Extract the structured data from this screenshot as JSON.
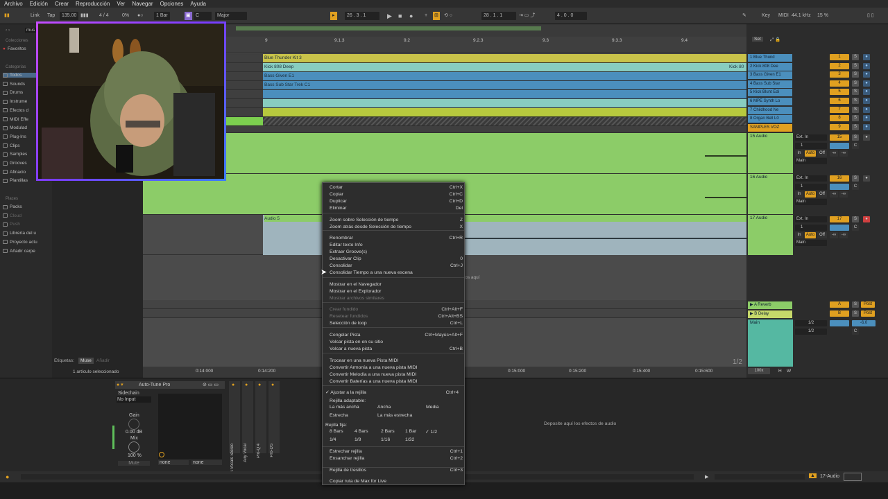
{
  "menubar": [
    "Archivo",
    "Edición",
    "Crear",
    "Reproducción",
    "Ver",
    "Navegar",
    "Opciones",
    "Ayuda"
  ],
  "transport": {
    "link": "Link",
    "tap": "Tap",
    "tempo": "135.00",
    "sig": "4 / 4",
    "pct": "0%",
    "quant": "1 Bar",
    "key": "C",
    "scale": "Major",
    "pos": "26 . 3 . 1",
    "loop_start": "28 . 1 . 1",
    "loop_len": "4 . 0 . 0",
    "key_label": "Key",
    "midi": "MIDI",
    "sample_rate": "44.1 kHz",
    "cpu": "15 %"
  },
  "browser": {
    "search": "mus",
    "section_colecciones": "Colecciones",
    "favoritos": "Favoritos",
    "section_categorias": "Categorías",
    "categorias": [
      "Todos",
      "Sounds",
      "Drums",
      "Instrume",
      "Efectos d",
      "MIDI Effe",
      "Modulad",
      "Plug-Ins",
      "Clips",
      "Samples",
      "Grooves",
      "Afinacio",
      "Plantillas"
    ],
    "section_lugares": "Places",
    "lugares": [
      "Packs",
      "Cloud",
      "Push",
      "Librería del u",
      "Proyecto actu",
      "Añadir carpe"
    ],
    "tags_label": "Etiquetas:",
    "tag1": "Muse",
    "tag2": "Añadir",
    "selected": "1 artículo seleccionado"
  },
  "ruler": {
    "marks": [
      "9",
      "9.1.3",
      "9.2",
      "9.2.3",
      "9.3",
      "9.3.3",
      "9.4"
    ],
    "set": "Set"
  },
  "clips": {
    "c1": "Blue Thunder Kit 3",
    "c2": "Kick 808 Deep",
    "c2b": "Kick 80",
    "c3": "Bass Given E1",
    "c4": "Bass Sub Star Trek C1",
    "audio5": "Audio 5",
    "drop_hint": "vos aquí",
    "page": "1/2"
  },
  "timeline": [
    "0:14:000",
    "0:14:200",
    "0:15:000",
    "0:15:200",
    "0:15:400",
    "0:15:600"
  ],
  "mixer": {
    "tracks": [
      {
        "name": "1 Blue Thund",
        "num": "1"
      },
      {
        "name": "2 Kick 808 Dee",
        "num": "2"
      },
      {
        "name": "3 Bass Given E1",
        "num": "3"
      },
      {
        "name": "4 Bass Sub Star",
        "num": "4"
      },
      {
        "name": "5 Kick Blunt Edi",
        "num": "5"
      },
      {
        "name": "6 MPE Synth Lo",
        "num": "6"
      },
      {
        "name": "7 Childhood Ne",
        "num": "7"
      },
      {
        "name": "8 Organ Bell L0",
        "num": "8"
      },
      {
        "name": "SAMPLES VOZ",
        "num": "9"
      }
    ],
    "audio": [
      {
        "name": "15 Audio",
        "num": "15"
      },
      {
        "name": "16 Audio",
        "num": "16"
      },
      {
        "name": "17 Audio",
        "num": "17"
      }
    ],
    "ext_in": "Ext. In",
    "ch": "1",
    "in": "In",
    "auto": "Auto",
    "off": "Off",
    "main": "Main",
    "inf": "-∞",
    "s": "S",
    "c": "C",
    "returns": [
      {
        "name": "A Reverb",
        "letter": "A"
      },
      {
        "name": "B Delay",
        "letter": "B"
      }
    ],
    "master": "Main",
    "half": "1/2",
    "post": "Post",
    "db": "-6.0",
    "zoom": "100x",
    "h": "H",
    "w": "W"
  },
  "device": {
    "title": "Auto-Tune Pro",
    "sidechain": "Sidechain",
    "noinput": "No Input",
    "gain": "Gain",
    "db": "0.00 dB",
    "mix": "Mix",
    "pct": "100 %",
    "mute": "Mute",
    "none1": "none",
    "none2": "none",
    "racks": [
      "CLA Vocals Stereo",
      "Airy Vocal",
      "Pro-Q 4",
      "Pro-DS"
    ],
    "drop": "Deposite aquí los efectos de audio"
  },
  "status": {
    "track": "17-Audio"
  },
  "context_menu": {
    "items": [
      {
        "l": "Cortar",
        "k": "Ctrl+X"
      },
      {
        "l": "Copiar",
        "k": "Ctrl+C"
      },
      {
        "l": "Duplicar",
        "k": "Ctrl+D"
      },
      {
        "l": "Eliminar",
        "k": "Del"
      },
      {
        "l": "Zoom sobre Selección de tiempo",
        "k": "Z"
      },
      {
        "l": "Zoom atrás desde Selección de tiempo",
        "k": "X"
      },
      {
        "l": "Renombrar",
        "k": "Ctrl+R"
      },
      {
        "l": "Editar texto Info",
        "k": ""
      },
      {
        "l": "Extraer Groove(s)",
        "k": ""
      },
      {
        "l": "Desactivar Clip",
        "k": "0"
      },
      {
        "l": "Consolidar",
        "k": "Ctrl+J"
      },
      {
        "l": "Consolidar Tiempo a una nueva escena",
        "k": ""
      },
      {
        "l": "Mostrar en el Navegador",
        "k": ""
      },
      {
        "l": "Mostrar en el Explorador",
        "k": ""
      },
      {
        "l": "Mostrar archivos similares",
        "k": ""
      },
      {
        "l": "Crear fundido",
        "k": "Ctrl+Alt+F"
      },
      {
        "l": "Resetear fundidos",
        "k": "Ctrl+Alt+BS"
      },
      {
        "l": "Selección de loop",
        "k": "Ctrl+L"
      },
      {
        "l": "Congelar Pista",
        "k": "Ctrl+Mayús+Alt+F"
      },
      {
        "l": "Volcar pista en en su sitio",
        "k": ""
      },
      {
        "l": "Volcar a nueva pista",
        "k": "Ctrl+B"
      },
      {
        "l": "Trocear en una nueva Pista MIDI",
        "k": ""
      },
      {
        "l": "Convertir Armonía a una nueva pista MIDI",
        "k": ""
      },
      {
        "l": "Convertir Melodía a una nueva pista MIDI",
        "k": ""
      },
      {
        "l": "Convertir Baterías a una nueva pista MIDI",
        "k": ""
      },
      {
        "l": "✓ Ajustar a la rejilla",
        "k": "Ctrl+4"
      },
      {
        "l": "Rejilla adaptable:",
        "k": ""
      }
    ],
    "adapt": [
      "La más ancha",
      "Ancha",
      "Media",
      "Estrecha",
      "La más estrecha"
    ],
    "fixed_label": "Rejilla fija:",
    "fixed": [
      "8 Bars",
      "4 Bars",
      "2 Bars",
      "1 Bar",
      "✓ 1/2",
      "1/4",
      "1/8",
      "1/16",
      "1/32"
    ],
    "tail": [
      {
        "l": "Estrechar rejilla",
        "k": "Ctrl+1"
      },
      {
        "l": "Ensanchar rejilla",
        "k": "Ctrl+2"
      },
      {
        "l": "Rejilla de tresillos",
        "k": "Ctrl+3"
      },
      {
        "l": "Copiar ruta de Max for Live",
        "k": ""
      }
    ]
  }
}
